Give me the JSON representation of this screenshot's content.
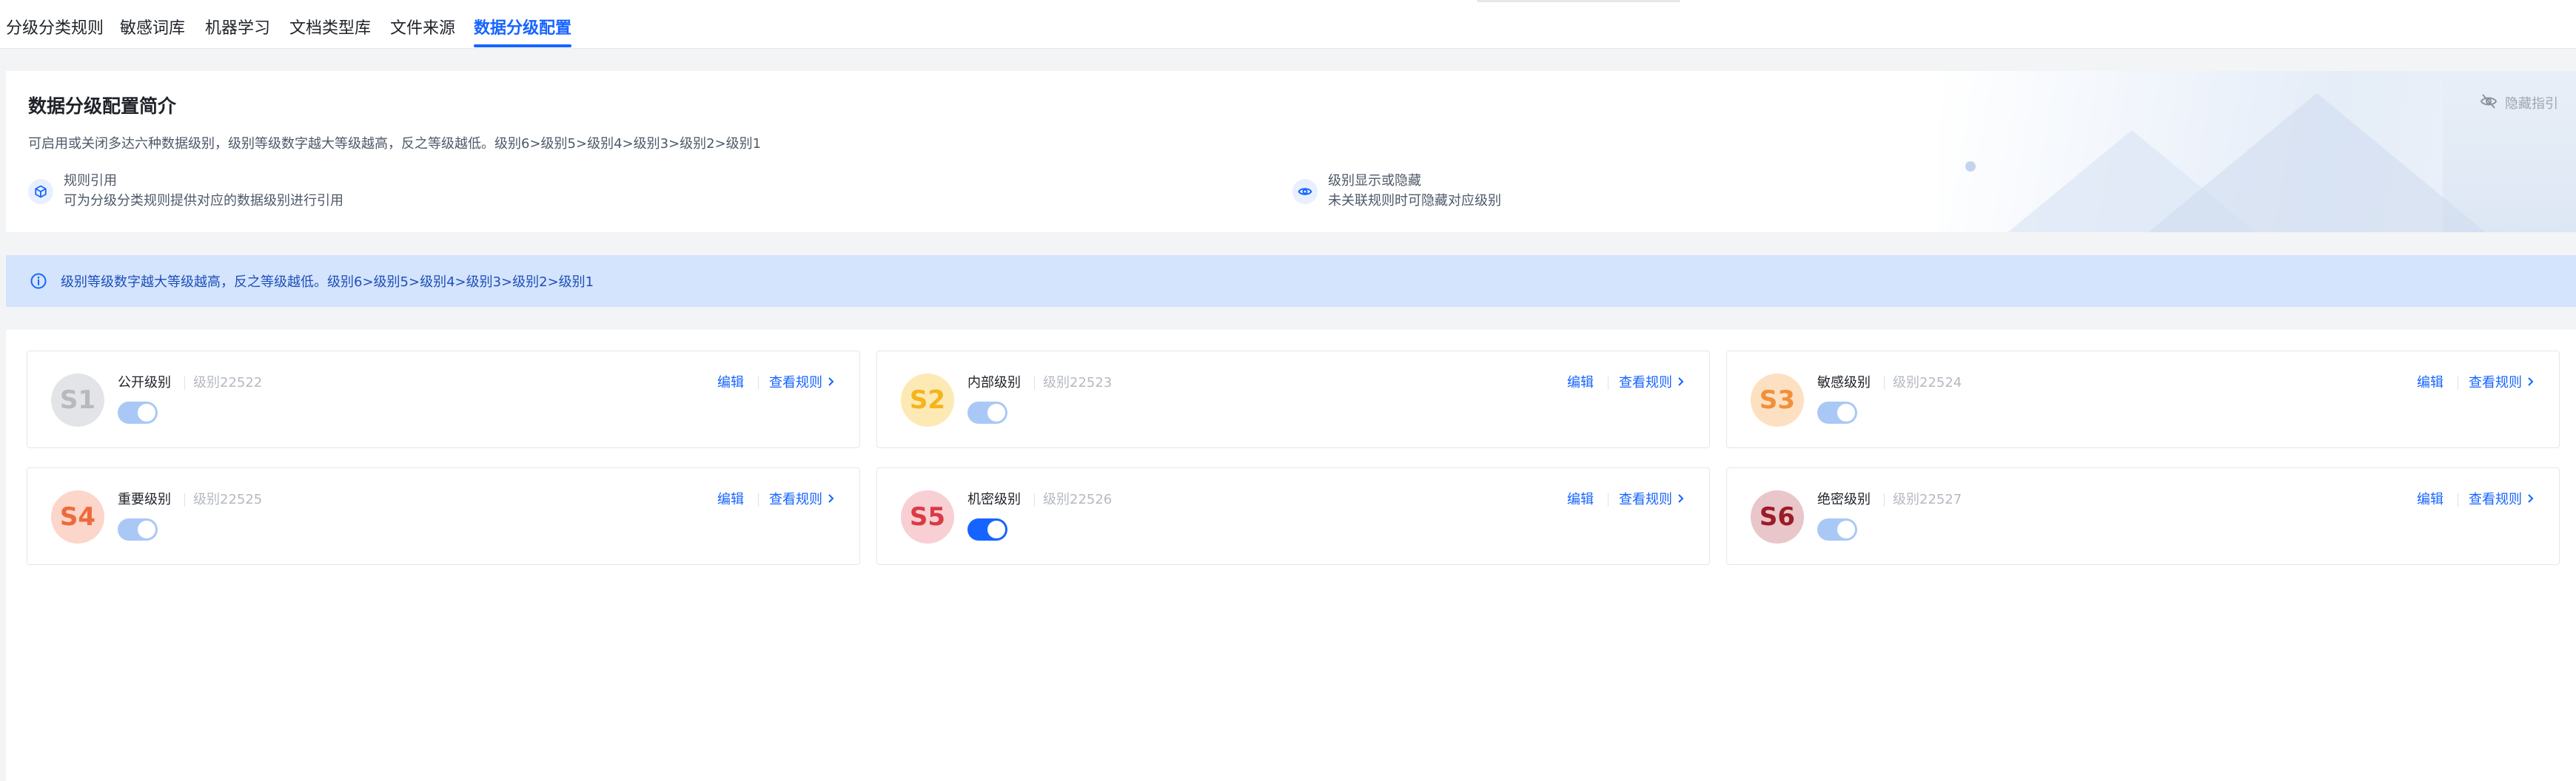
{
  "tabs": [
    {
      "label": "分级分类规则",
      "active": false
    },
    {
      "label": "敏感词库",
      "active": false
    },
    {
      "label": "机器学习",
      "active": false
    },
    {
      "label": "文档类型库",
      "active": false
    },
    {
      "label": "文件来源",
      "active": false
    },
    {
      "label": "数据分级配置",
      "active": true
    }
  ],
  "intro": {
    "title": "数据分级配置简介",
    "description": "可启用或关闭多达六种数据级别，级别等级数字越大等级越高，反之等级越低。级别6>级别5>级别4>级别3>级别2>级别1",
    "hide_label": "隐藏指引",
    "features": [
      {
        "icon": "cube-icon",
        "title": "规则引用",
        "desc": "可为分级分类规则提供对应的数据级别进行引用"
      },
      {
        "icon": "eye-icon",
        "title": "级别显示或隐藏",
        "desc": "未关联规则时可隐藏对应级别"
      }
    ]
  },
  "notice": {
    "icon": "info-icon",
    "text": "级别等级数字越大等级越高，反之等级越低。级别6>级别5>级别4>级别3>级别2>级别1"
  },
  "actions": {
    "edit": "编辑",
    "view_rules": "查看规则"
  },
  "levels": [
    {
      "badge": "S1",
      "name": "公开级别",
      "code": "级别22522",
      "enabled": true,
      "badge_bg": "#e3e4e7",
      "badge_fg": "#b6b9be"
    },
    {
      "badge": "S2",
      "name": "内部级别",
      "code": "级别22523",
      "enabled": true,
      "badge_bg": "#fde9b3",
      "badge_fg": "#f4b41a"
    },
    {
      "badge": "S3",
      "name": "敏感级别",
      "code": "级别22524",
      "enabled": true,
      "badge_bg": "#fde0c2",
      "badge_fg": "#f0903a"
    },
    {
      "badge": "S4",
      "name": "重要级别",
      "code": "级别22525",
      "enabled": true,
      "badge_bg": "#fcd6ca",
      "badge_fg": "#ee6a3c"
    },
    {
      "badge": "S5",
      "name": "机密级别",
      "code": "级别22526",
      "enabled": true,
      "badge_bg": "#f8cfd2",
      "badge_fg": "#d93a44"
    },
    {
      "badge": "S6",
      "name": "绝密级别",
      "code": "级别22527",
      "enabled": true,
      "badge_bg": "#e8c6c9",
      "badge_fg": "#9b1c27"
    }
  ],
  "colors": {
    "primary": "#1664ff",
    "notice_bg": "#d4e4fd",
    "notice_text": "#1d4fb8"
  }
}
